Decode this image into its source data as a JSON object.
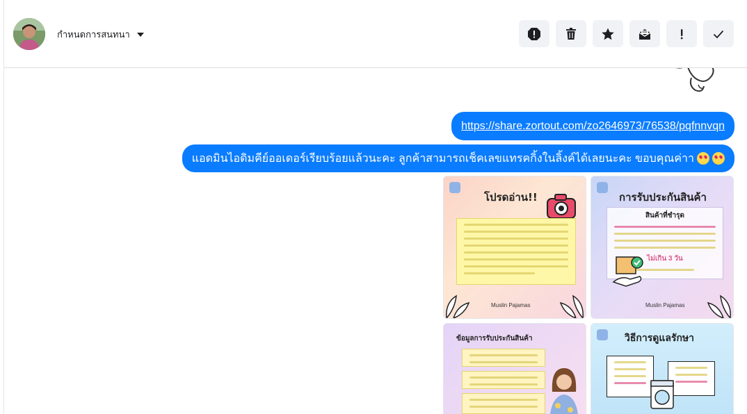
{
  "header": {
    "conversation_label": "กำหนดการสนทนา",
    "actions": [
      {
        "name": "report-icon",
        "label": "report"
      },
      {
        "name": "trash-icon",
        "label": "delete"
      },
      {
        "name": "star-icon",
        "label": "star"
      },
      {
        "name": "mark-unread-icon",
        "label": "mark unread"
      },
      {
        "name": "exclamation-icon",
        "label": "important"
      },
      {
        "name": "check-icon",
        "label": "done"
      }
    ]
  },
  "messages": {
    "link_text": "https://share.zortout.com/zo2646973/76538/pqfnnvqn",
    "text_message": "แอดมินไอดิมคีย์ออเดอร์เรียบร้อยแล้วนะคะ ลูกค้าสามารถเช็คเลขแทรคกิ้งในลิ้งค์ได้เลยนะคะ ขอบคุณค่าา"
  },
  "images": {
    "tile1": {
      "title": "โปรดอ่าน!!",
      "brand": "Muslin Pajamas"
    },
    "tile2": {
      "title": "การรับประกันสินค้า",
      "subtitle": "สินค้าที่ชำรุด",
      "highlight": "ไม่เกิน 3 วัน",
      "brand": "Muslin Pajamas"
    },
    "tile3": {
      "title": "ข้อมูลการรับประกันสินค้า"
    },
    "tile4": {
      "title": "วิธีการดูแลรักษา"
    }
  },
  "colors": {
    "accent": "#0a7cff",
    "button_bg": "#f0f2f5"
  }
}
